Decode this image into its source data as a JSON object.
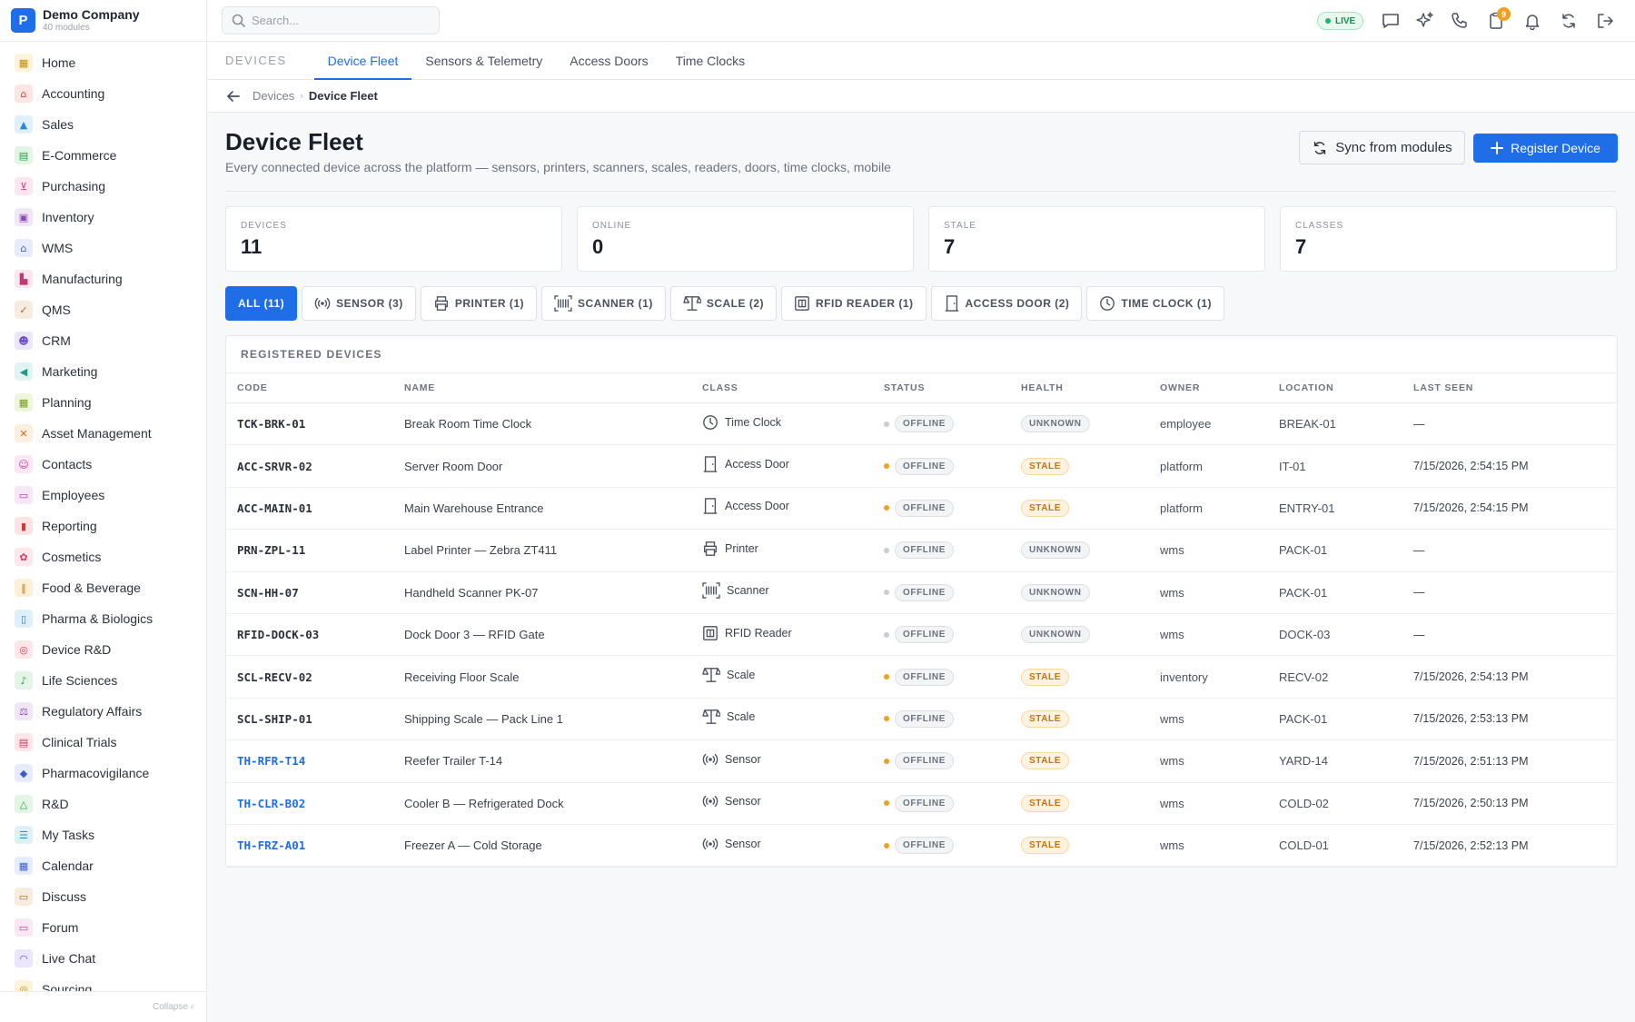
{
  "brand": {
    "logo_letter": "P",
    "name": "Demo Company",
    "sub": "40 modules"
  },
  "sidebar": {
    "items": [
      {
        "label": "Home",
        "icon": "grid-icon",
        "glyph": "▦",
        "bg": "#fdf3d8",
        "fg": "#c08a10"
      },
      {
        "label": "Accounting",
        "icon": "bank-icon",
        "glyph": "⌂",
        "bg": "#fde5e3",
        "fg": "#d0443a"
      },
      {
        "label": "Sales",
        "icon": "flask-icon",
        "glyph": "▲",
        "bg": "#e0f0fb",
        "fg": "#2a8ad0"
      },
      {
        "label": "E-Commerce",
        "icon": "store-icon",
        "glyph": "▤",
        "bg": "#e3f6e6",
        "fg": "#2e9e4a"
      },
      {
        "label": "Purchasing",
        "icon": "cart-icon",
        "glyph": "⊻",
        "bg": "#fde6ef",
        "fg": "#d03c7a"
      },
      {
        "label": "Inventory",
        "icon": "box-icon",
        "glyph": "▣",
        "bg": "#f0e6f6",
        "fg": "#8a4ab0"
      },
      {
        "label": "WMS",
        "icon": "warehouse-icon",
        "glyph": "⌂",
        "bg": "#e6ecfb",
        "fg": "#3a62c8"
      },
      {
        "label": "Manufacturing",
        "icon": "factory-icon",
        "glyph": "▙",
        "bg": "#fbe6ef",
        "fg": "#c03a72"
      },
      {
        "label": "QMS",
        "icon": "badge-icon",
        "glyph": "✓",
        "bg": "#f6ece0",
        "fg": "#a8702a"
      },
      {
        "label": "CRM",
        "icon": "users-icon",
        "glyph": "☻",
        "bg": "#ebe6fb",
        "fg": "#6a4ad0"
      },
      {
        "label": "Marketing",
        "icon": "megaphone-icon",
        "glyph": "◀",
        "bg": "#e0f4f2",
        "fg": "#1e9a8a"
      },
      {
        "label": "Planning",
        "icon": "calendar-icon",
        "glyph": "▦",
        "bg": "#eef6dc",
        "fg": "#7a9a20"
      },
      {
        "label": "Asset Management",
        "icon": "tools-icon",
        "glyph": "✕",
        "bg": "#fdeee0",
        "fg": "#d06a1a"
      },
      {
        "label": "Contacts",
        "icon": "contact-icon",
        "glyph": "☺",
        "bg": "#fbe6f3",
        "fg": "#c03a92"
      },
      {
        "label": "Employees",
        "icon": "briefcase-icon",
        "glyph": "▭",
        "bg": "#f6e6f6",
        "fg": "#a03ab0"
      },
      {
        "label": "Reporting",
        "icon": "bar-chart-icon",
        "glyph": "▮",
        "bg": "#fde3e3",
        "fg": "#d03a3a"
      },
      {
        "label": "Cosmetics",
        "icon": "flower-icon",
        "glyph": "✿",
        "bg": "#fde6ec",
        "fg": "#d03a62"
      },
      {
        "label": "Food & Beverage",
        "icon": "utensils-icon",
        "glyph": "‖",
        "bg": "#fdefd8",
        "fg": "#c07a1a"
      },
      {
        "label": "Pharma & Biologics",
        "icon": "pill-icon",
        "glyph": "▯",
        "bg": "#e0f0fb",
        "fg": "#2a7ac0"
      },
      {
        "label": "Device R&D",
        "icon": "chip-icon",
        "glyph": "◎",
        "bg": "#fde6ea",
        "fg": "#d0405a"
      },
      {
        "label": "Life Sciences",
        "icon": "microscope-icon",
        "glyph": "♪",
        "bg": "#e3f6e6",
        "fg": "#2e9e4a"
      },
      {
        "label": "Regulatory Affairs",
        "icon": "scale-icon",
        "glyph": "⚖",
        "bg": "#f0e6f6",
        "fg": "#8a4ab0"
      },
      {
        "label": "Clinical Trials",
        "icon": "clipboard-icon",
        "glyph": "▤",
        "bg": "#fde6ea",
        "fg": "#c03a5a"
      },
      {
        "label": "Pharmacovigilance",
        "icon": "shield-icon",
        "glyph": "◆",
        "bg": "#e6ecfb",
        "fg": "#3a5ac8"
      },
      {
        "label": "R&D",
        "icon": "beaker-icon",
        "glyph": "△",
        "bg": "#e3f6e6",
        "fg": "#2e9e4a"
      },
      {
        "label": "My Tasks",
        "icon": "checklist-icon",
        "glyph": "☰",
        "bg": "#e0f0fb",
        "fg": "#2a8ad0"
      },
      {
        "label": "Calendar",
        "icon": "calendar-icon",
        "glyph": "▦",
        "bg": "#e6ecfb",
        "fg": "#3a62c8"
      },
      {
        "label": "Discuss",
        "icon": "chat-icon",
        "glyph": "▭",
        "bg": "#f6ece0",
        "fg": "#a8702a"
      },
      {
        "label": "Forum",
        "icon": "forum-icon",
        "glyph": "▭",
        "bg": "#fbe6f3",
        "fg": "#c03a92"
      },
      {
        "label": "Live Chat",
        "icon": "headset-icon",
        "glyph": "◠",
        "bg": "#ebe6fb",
        "fg": "#6a4ad0"
      },
      {
        "label": "Sourcing",
        "icon": "target-icon",
        "glyph": "◎",
        "bg": "#fdf3d8",
        "fg": "#c08a10"
      }
    ],
    "collapse_label": "Collapse ‹"
  },
  "topbar": {
    "search_placeholder": "Search...",
    "live_label": "LIVE",
    "notif_count": "9"
  },
  "tabs": {
    "section_label": "DEVICES",
    "items": [
      {
        "label": "Device Fleet"
      },
      {
        "label": "Sensors & Telemetry"
      },
      {
        "label": "Access Doors"
      },
      {
        "label": "Time Clocks"
      }
    ]
  },
  "breadcrumb": {
    "parent": "Devices",
    "separator": "›",
    "current": "Device Fleet"
  },
  "page": {
    "title": "Device Fleet",
    "subtitle": "Every connected device across the platform — sensors, printers, scanners, scales, readers, doors, time clocks, mobile",
    "sync_label": "Sync from modules",
    "register_label": "Register Device"
  },
  "stats": [
    {
      "label": "DEVICES",
      "value": "11"
    },
    {
      "label": "ONLINE",
      "value": "0"
    },
    {
      "label": "STALE",
      "value": "7"
    },
    {
      "label": "CLASSES",
      "value": "7"
    }
  ],
  "filters": [
    {
      "label": "ALL (11)",
      "icon": ""
    },
    {
      "label": "SENSOR (3)",
      "icon": "sensor-icon"
    },
    {
      "label": "PRINTER (1)",
      "icon": "printer-icon"
    },
    {
      "label": "SCANNER (1)",
      "icon": "scanner-icon"
    },
    {
      "label": "SCALE (2)",
      "icon": "scale-icon"
    },
    {
      "label": "RFID READER (1)",
      "icon": "rfid-icon"
    },
    {
      "label": "ACCESS DOOR (2)",
      "icon": "door-icon"
    },
    {
      "label": "TIME CLOCK (1)",
      "icon": "clock-icon"
    }
  ],
  "table": {
    "title": "REGISTERED DEVICES",
    "columns": [
      "CODE",
      "NAME",
      "CLASS",
      "STATUS",
      "HEALTH",
      "OWNER",
      "LOCATION",
      "LAST SEEN"
    ],
    "rows": [
      {
        "code": "TCK-BRK-01",
        "name": "Break Room Time Clock",
        "class": "Time Clock",
        "class_icon": "clock-icon",
        "status": "OFFLINE",
        "dot": "#c8ccd3",
        "health": "UNKNOWN",
        "owner": "employee",
        "location": "BREAK-01",
        "last_seen": "—",
        "link": false
      },
      {
        "code": "ACC-SRVR-02",
        "name": "Server Room Door",
        "class": "Access Door",
        "class_icon": "door-icon",
        "status": "OFFLINE",
        "dot": "#f0a020",
        "health": "STALE",
        "owner": "platform",
        "location": "IT-01",
        "last_seen": "7/15/2026, 2:54:15 PM",
        "link": false
      },
      {
        "code": "ACC-MAIN-01",
        "name": "Main Warehouse Entrance",
        "class": "Access Door",
        "class_icon": "door-icon",
        "status": "OFFLINE",
        "dot": "#f0a020",
        "health": "STALE",
        "owner": "platform",
        "location": "ENTRY-01",
        "last_seen": "7/15/2026, 2:54:15 PM",
        "link": false
      },
      {
        "code": "PRN-ZPL-11",
        "name": "Label Printer — Zebra ZT411",
        "class": "Printer",
        "class_icon": "printer-icon",
        "status": "OFFLINE",
        "dot": "#c8ccd3",
        "health": "UNKNOWN",
        "owner": "wms",
        "location": "PACK-01",
        "last_seen": "—",
        "link": false
      },
      {
        "code": "SCN-HH-07",
        "name": "Handheld Scanner PK-07",
        "class": "Scanner",
        "class_icon": "scanner-icon",
        "status": "OFFLINE",
        "dot": "#c8ccd3",
        "health": "UNKNOWN",
        "owner": "wms",
        "location": "PACK-01",
        "last_seen": "—",
        "link": false
      },
      {
        "code": "RFID-DOCK-03",
        "name": "Dock Door 3 — RFID Gate",
        "class": "RFID Reader",
        "class_icon": "rfid-icon",
        "status": "OFFLINE",
        "dot": "#c8ccd3",
        "health": "UNKNOWN",
        "owner": "wms",
        "location": "DOCK-03",
        "last_seen": "—",
        "link": false
      },
      {
        "code": "SCL-RECV-02",
        "name": "Receiving Floor Scale",
        "class": "Scale",
        "class_icon": "scale-icon",
        "status": "OFFLINE",
        "dot": "#f0a020",
        "health": "STALE",
        "owner": "inventory",
        "location": "RECV-02",
        "last_seen": "7/15/2026, 2:54:13 PM",
        "link": false
      },
      {
        "code": "SCL-SHIP-01",
        "name": "Shipping Scale — Pack Line 1",
        "class": "Scale",
        "class_icon": "scale-icon",
        "status": "OFFLINE",
        "dot": "#f0a020",
        "health": "STALE",
        "owner": "wms",
        "location": "PACK-01",
        "last_seen": "7/15/2026, 2:53:13 PM",
        "link": false
      },
      {
        "code": "TH-RFR-T14",
        "name": "Reefer Trailer T-14",
        "class": "Sensor",
        "class_icon": "sensor-icon",
        "status": "OFFLINE",
        "dot": "#f0a020",
        "health": "STALE",
        "owner": "wms",
        "location": "YARD-14",
        "last_seen": "7/15/2026, 2:51:13 PM",
        "link": true
      },
      {
        "code": "TH-CLR-B02",
        "name": "Cooler B — Refrigerated Dock",
        "class": "Sensor",
        "class_icon": "sensor-icon",
        "status": "OFFLINE",
        "dot": "#f0a020",
        "health": "STALE",
        "owner": "wms",
        "location": "COLD-02",
        "last_seen": "7/15/2026, 2:50:13 PM",
        "link": true
      },
      {
        "code": "TH-FRZ-A01",
        "name": "Freezer A — Cold Storage",
        "class": "Sensor",
        "class_icon": "sensor-icon",
        "status": "OFFLINE",
        "dot": "#f0a020",
        "health": "STALE",
        "owner": "wms",
        "location": "COLD-01",
        "last_seen": "7/15/2026, 2:52:13 PM",
        "link": true
      }
    ]
  },
  "colors": {
    "accent": "#1f6ee8",
    "stale": "#c07310",
    "live": "#1c8a50"
  }
}
